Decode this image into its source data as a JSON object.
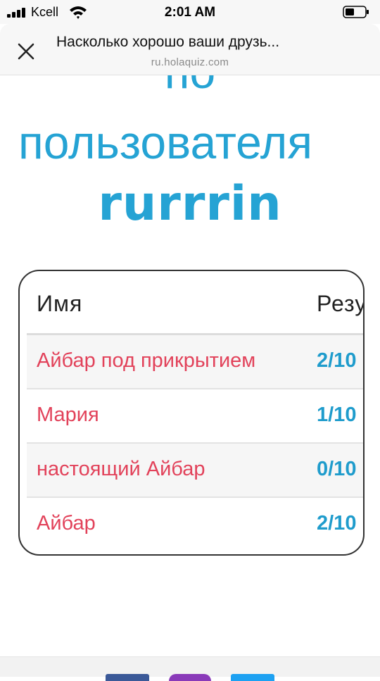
{
  "status": {
    "carrier": "Kcell",
    "time": "2:01 AM",
    "signal_icon": "signal-bars-icon",
    "wifi_icon": "wifi-icon",
    "battery_icon": "battery-icon"
  },
  "browser": {
    "title": "Насколько хорошо ваши друзь...",
    "url": "ru.holaquiz.com",
    "close_icon": "close-icon"
  },
  "heading": {
    "line1": "по",
    "line2": "пользователя",
    "username": "rurrrin"
  },
  "table": {
    "col_name": "Имя",
    "col_score": "Результат",
    "rows": [
      {
        "name": "Айбар под прикрытием",
        "score": "2/10"
      },
      {
        "name": "Мария",
        "score": "1/10"
      },
      {
        "name": "настоящий Айбар",
        "score": "0/10"
      },
      {
        "name": "Айбар",
        "score": "2/10"
      }
    ]
  },
  "share_colors": {
    "facebook": "#3b5998",
    "instagram": "#8a3ab9",
    "twitter": "#1da1f2"
  },
  "colors": {
    "accent": "#25a3d4",
    "name_text": "#e2425a",
    "score_text": "#1f9ccc"
  }
}
